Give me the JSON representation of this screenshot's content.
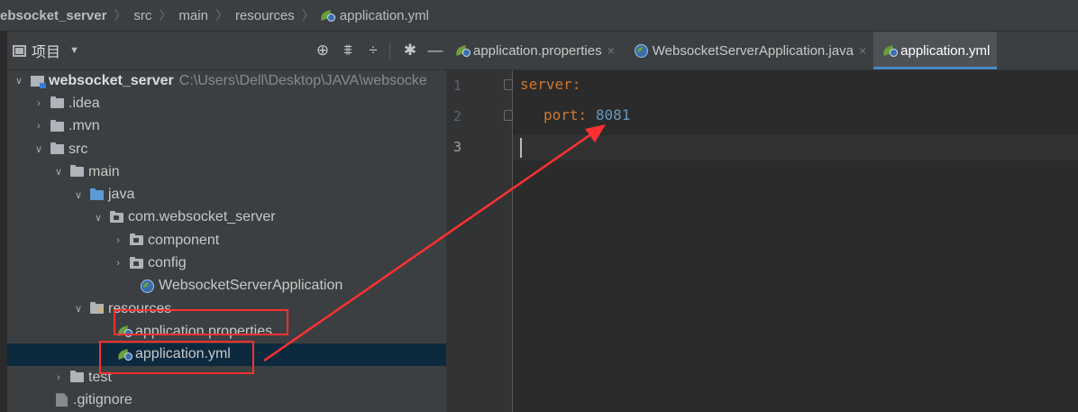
{
  "breadcrumb": {
    "items": [
      "ebsocket_server",
      "src",
      "main",
      "resources",
      "application.yml"
    ]
  },
  "project_panel": {
    "title": "项目",
    "tree": [
      {
        "label": "websocket_server",
        "path": "C:\\Users\\Dell\\Desktop\\JAVA\\websocke"
      },
      {
        "label": ".idea"
      },
      {
        "label": ".mvn"
      },
      {
        "label": "src"
      },
      {
        "label": "main"
      },
      {
        "label": "java"
      },
      {
        "label": "com.websocket_server"
      },
      {
        "label": "component"
      },
      {
        "label": "config"
      },
      {
        "label": "WebsocketServerApplication"
      },
      {
        "label": "resources"
      },
      {
        "label": "application.properties"
      },
      {
        "label": "application.yml"
      },
      {
        "label": "test"
      },
      {
        "label": ".gitignore"
      }
    ]
  },
  "tabs": [
    {
      "label": "application.properties"
    },
    {
      "label": "WebsocketServerApplication.java"
    },
    {
      "label": "application.yml",
      "active": true
    }
  ],
  "editor": {
    "line_numbers": [
      "1",
      "2",
      "3"
    ],
    "lines": [
      {
        "key": "server",
        "colon": ":",
        "value": ""
      },
      {
        "key": "port",
        "colon": ":",
        "value": "8081"
      }
    ]
  },
  "colors": {
    "annotation": "#ff3030",
    "yaml_key": "#cc7832",
    "yaml_number": "#6897bb",
    "selection": "#0d293e"
  }
}
